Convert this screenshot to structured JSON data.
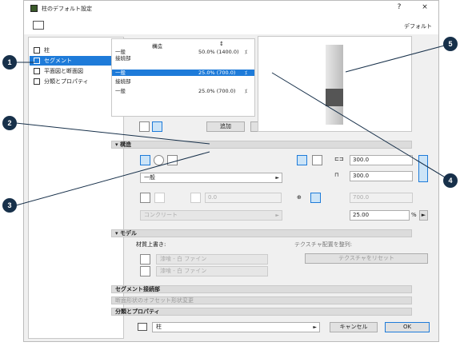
{
  "window": {
    "title": "柱のデフォルト設定",
    "help": "?",
    "close": "×",
    "default_label": "デフォルト"
  },
  "sidebar": {
    "items": [
      {
        "label": "柱",
        "icon": "column-icon"
      },
      {
        "label": "セグメント",
        "icon": "segment-icon",
        "selected": true
      },
      {
        "label": "平面図と断面図",
        "icon": "floorplan-icon"
      },
      {
        "label": "分類とプロパティ",
        "icon": "classification-icon"
      }
    ]
  },
  "segments": {
    "headers": {
      "structure": "構造",
      "size_icon": "↕"
    },
    "rows": [
      {
        "name": "一般",
        "value": "50.0% (1400.0)",
        "mark": "⁒"
      },
      {
        "name": "接続部",
        "value": "",
        "mark": ""
      },
      {
        "name": "一般",
        "value": "25.0% (700.0)",
        "mark": "⁒",
        "selected": true
      },
      {
        "name": "接続部",
        "value": "",
        "mark": ""
      },
      {
        "name": "一般",
        "value": "25.0% (700.0)",
        "mark": "⁒"
      }
    ],
    "add_label": "追加",
    "delete_label": "削除"
  },
  "structure": {
    "section_title": "構造",
    "profile_value": "一般",
    "width": "300.0",
    "depth": "300.0",
    "core_value": "0.0",
    "length_value": "700.0",
    "material_value": "コンクリート",
    "percent_value": "25.00",
    "percent_unit": "%"
  },
  "model": {
    "section_title": "モデル",
    "override_label": "材質上書き:",
    "texture_label": "テクスチャ配置を整列:",
    "reset_texture": "テクスチャをリセット",
    "surface1": "漆喰 - 白 ファイン",
    "surface2": "漆喰 - 白 ファイン"
  },
  "sections": {
    "joint": "セグメント接続部",
    "offset": "断面形状のオフセット形状変更",
    "classification": "分類とプロパティ"
  },
  "footer": {
    "layer": "柱",
    "cancel": "キャンセル",
    "ok": "OK"
  },
  "callouts": [
    "1",
    "2",
    "3",
    "4",
    "5"
  ],
  "colors": {
    "accent": "#1e7bd9",
    "callout": "#17304a"
  }
}
